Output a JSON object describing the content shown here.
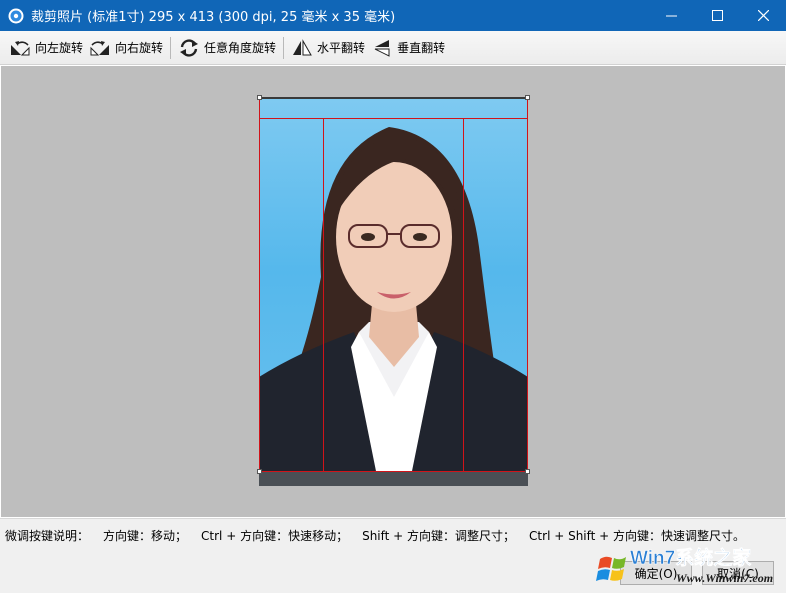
{
  "window": {
    "title": "裁剪照片 (标准1寸) 295 x 413 (300 dpi, 25 毫米 x 35 毫米)",
    "minimize_icon": "minimize-icon",
    "maximize_icon": "maximize-icon",
    "close_icon": "close-icon"
  },
  "toolbar": {
    "rotate_left": "向左旋转",
    "rotate_right": "向右旋转",
    "rotate_any": "任意角度旋转",
    "flip_horizontal": "水平翻转",
    "flip_vertical": "垂直翻转"
  },
  "status": {
    "intro": "微调按键说明：",
    "arrow": "方向键：移动；",
    "ctrl_arrow": "Ctrl + 方向键：快速移动；",
    "shift_arrow": "Shift + 方向键：调整尺寸；",
    "ctrl_shift_arrow": "Ctrl + Shift + 方向键：快速调整尺寸。"
  },
  "buttons": {
    "ok": "确定(O)",
    "cancel": "取消(C)"
  },
  "watermark": {
    "brand": "Win7系统之家",
    "url": "Www.Winwin7.com"
  },
  "colors": {
    "titlebar": "#1066b7",
    "crop_guides": "#d0141a",
    "canvas": "#bebebe",
    "photo_background": "#5bbcee"
  }
}
